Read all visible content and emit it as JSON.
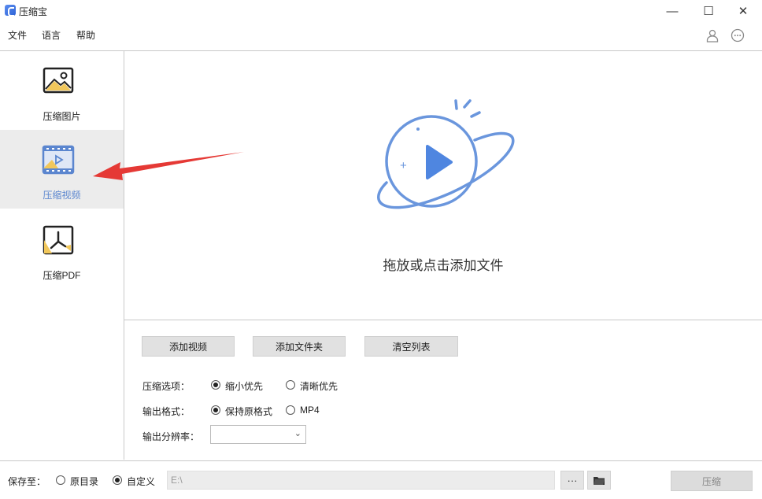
{
  "window": {
    "title": "压缩宝",
    "minimize": "—",
    "maximize": "☐",
    "close": "✕"
  },
  "menu": [
    "文件",
    "语言",
    "帮助"
  ],
  "sidebar": {
    "items": [
      {
        "label": "压缩图片",
        "icon": "image-icon"
      },
      {
        "label": "压缩视频",
        "icon": "video-icon",
        "active": true
      },
      {
        "label": "压缩PDF",
        "icon": "pdf-icon"
      }
    ]
  },
  "dropzone": {
    "text": "拖放或点击添加文件",
    "icon": "planet-play-icon"
  },
  "buttons": {
    "add_video": "添加视频",
    "add_folder": "添加文件夹",
    "clear_list": "清空列表"
  },
  "options": {
    "compress_label": "压缩选项：",
    "compress_choices": [
      "缩小优先",
      "清晰优先"
    ],
    "compress_selected": 0,
    "format_label": "输出格式：",
    "format_choices": [
      "保持原格式",
      "MP4"
    ],
    "format_selected": 0,
    "resolution_label": "输出分辨率：",
    "resolution_value": ""
  },
  "footer": {
    "save_to_label": "保存至：",
    "save_choices": [
      "原目录",
      "自定义"
    ],
    "save_selected": 1,
    "path_value": "E:\\",
    "more_label": "···",
    "compress_label": "压缩"
  },
  "colors": {
    "accent": "#5b86cf",
    "annotation_arrow": "#e53935"
  }
}
